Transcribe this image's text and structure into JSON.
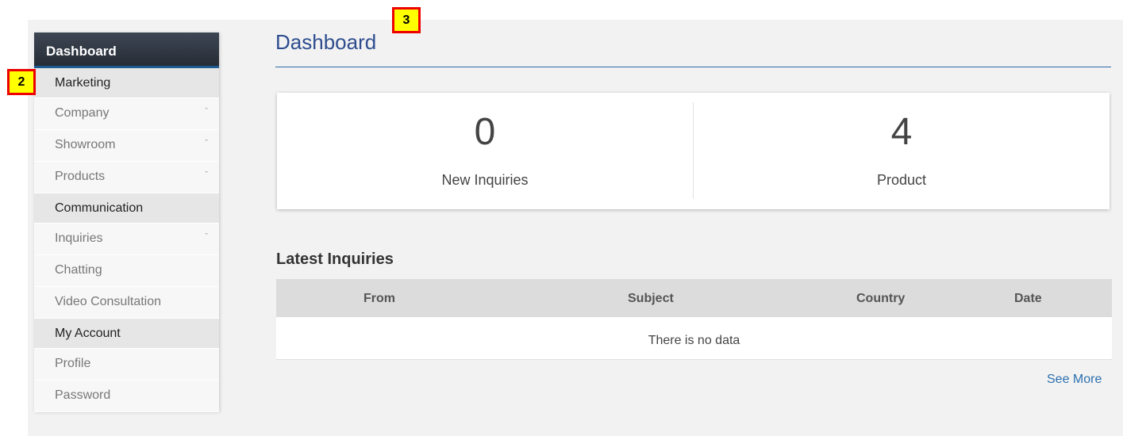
{
  "sidebar": {
    "header": "Dashboard",
    "sections": [
      {
        "label": "Marketing",
        "items": [
          {
            "label": "Company",
            "chevron": true
          },
          {
            "label": "Showroom",
            "chevron": true
          },
          {
            "label": "Products",
            "chevron": true
          }
        ]
      },
      {
        "label": "Communication",
        "items": [
          {
            "label": "Inquiries",
            "chevron": true
          },
          {
            "label": "Chatting",
            "chevron": false
          },
          {
            "label": "Video Consultation",
            "chevron": false
          }
        ]
      },
      {
        "label": "My Account",
        "items": [
          {
            "label": "Profile",
            "chevron": false
          },
          {
            "label": "Password",
            "chevron": false
          }
        ]
      }
    ],
    "chevron_glyph": "ˇ"
  },
  "main": {
    "title": "Dashboard",
    "stats": [
      {
        "value": "0",
        "label": "New Inquiries"
      },
      {
        "value": "4",
        "label": "Product"
      }
    ],
    "latest_title": "Latest Inquiries",
    "table": {
      "columns": [
        "From",
        "Subject",
        "Country",
        "Date"
      ],
      "empty_text": "There is no data"
    },
    "see_more": "See More"
  },
  "annotations": {
    "badge_2": "2",
    "badge_3": "3"
  },
  "colors": {
    "accent": "#2e4d8f",
    "link": "#2a6fb0",
    "sidebar_header": "#2f3741",
    "badge_fill": "#ffff00",
    "badge_border": "#ee0000"
  }
}
